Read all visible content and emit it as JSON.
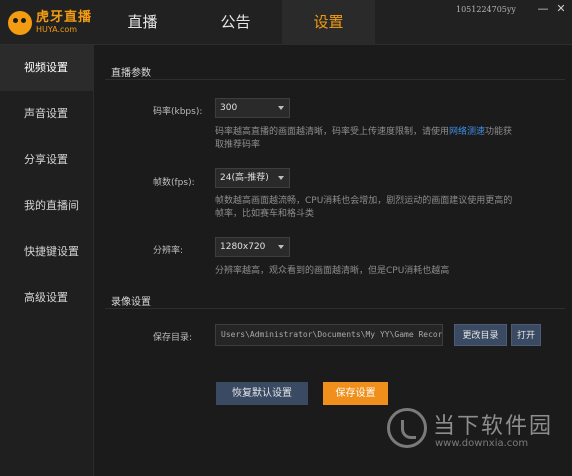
{
  "logo": {
    "name": "虎牙直播",
    "sub": "HUYA.com"
  },
  "tabs": [
    "直播",
    "公告",
    "设置"
  ],
  "account": "1051224705yy",
  "window": {
    "minimize": "—",
    "close": "✕"
  },
  "sidebar": {
    "items": [
      {
        "label": "视频设置",
        "active": true
      },
      {
        "label": "声音设置"
      },
      {
        "label": "分享设置"
      },
      {
        "label": "我的直播间"
      },
      {
        "label": "快捷键设置"
      },
      {
        "label": "高级设置"
      }
    ]
  },
  "live": {
    "title": "直播参数",
    "bitrate": {
      "label": "码率(kbps):",
      "value": "300",
      "hint_before": "码率越高直播的画面越清晰，码率受上传速度限制，请使用",
      "hint_link": "网络测速",
      "hint_after": "功能获取推荐码率"
    },
    "fps": {
      "label": "帧数(fps):",
      "value": "24(高-推荐)",
      "hint": "帧数越高画面越流畅，CPU消耗也会增加，剧烈运动的画面建议使用更高的帧率，比如赛车和格斗类"
    },
    "resolution": {
      "label": "分辨率:",
      "value": "1280x720",
      "hint": "分辨率越高，观众看到的画面越清晰，但是CPU消耗也越高"
    }
  },
  "record": {
    "title": "录像设置",
    "dir_label": "保存目录:",
    "dir_value": "Users\\Administrator\\Documents\\My YY\\Game Record",
    "change_label": "更改目录",
    "open_label": "打开"
  },
  "actions": {
    "reset_label": "恢复默认设置",
    "save_label": "保存设置"
  },
  "watermark": {
    "text": "当下软件园",
    "url": "www.downxia.com"
  },
  "colors": {
    "accent": "#f39c12",
    "save": "#f18f1c",
    "secondary_button": "#3a4a62",
    "link": "#3d8fe8"
  }
}
